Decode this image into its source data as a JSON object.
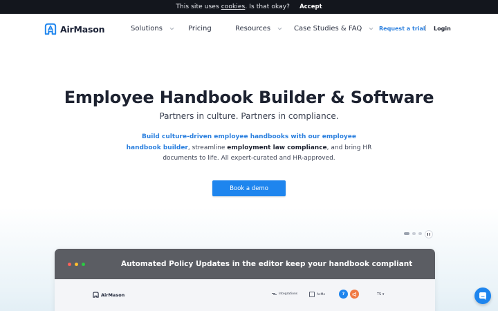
{
  "cookie": {
    "prefix": "This site uses ",
    "link": "cookies",
    "suffix": ". Is that okay?",
    "accept": "Accept"
  },
  "header": {
    "logo": "AirMason",
    "nav": [
      {
        "label": "Solutions",
        "has_dropdown": true
      },
      {
        "label": "Pricing",
        "has_dropdown": false
      },
      {
        "label": "Resources",
        "has_dropdown": true
      },
      {
        "label": "Case Studies & FAQ",
        "has_dropdown": true
      }
    ],
    "trial": "Request a trial",
    "separator": "|",
    "login": "Login"
  },
  "hero": {
    "title": "Employee Handbook Builder & Software",
    "subtitle": "Partners in culture. Partners in compliance.",
    "desc_link": "Build culture-driven employee handbooks with our employee handbook builder",
    "desc_part1": ", streamline ",
    "desc_bold": "employment law compliance",
    "desc_part2": ", and bring HR documents to life. All expert-curated and HR-approved.",
    "cta": "Book a demo"
  },
  "slider": {
    "count": 3,
    "active_index": 0,
    "pause_icon": "pause-icon"
  },
  "preview": {
    "title": "Automated Policy Updates in the editor keep your handbook compliant",
    "inner_logo": "AirMason",
    "integrations": "Integrations",
    "company": "AcMe",
    "help": "?",
    "user": "TS"
  },
  "colors": {
    "accent": "#1e85ee",
    "link": "#2a7fde",
    "dark": "#13161d",
    "orange": "#f07a43"
  }
}
